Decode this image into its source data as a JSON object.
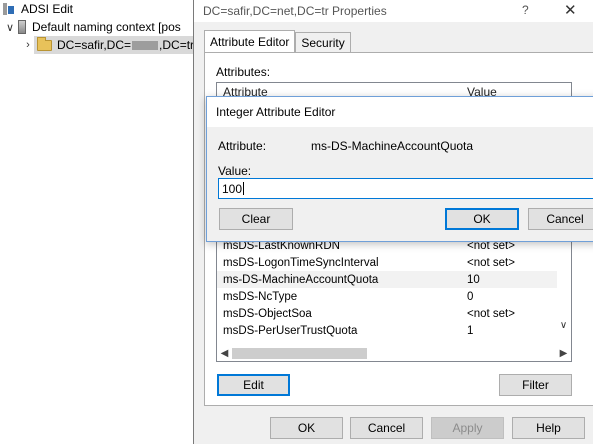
{
  "tree": {
    "root_label": "ADSI Edit",
    "context_label": "Default naming context [pos",
    "node_label_prefix": "DC=safir,DC=",
    "node_label_suffix": ",DC=tr"
  },
  "properties": {
    "title": "DC=safir,DC=net,DC=tr Properties",
    "help_glyph": "?",
    "close_glyph": "✕",
    "tabs": [
      "Attribute Editor",
      "Security"
    ],
    "attributes_label": "Attributes:",
    "columns": [
      "Attribute",
      "Value"
    ],
    "rows": [
      {
        "attr": "msDS-LastKnownRDN",
        "value": "<not set>"
      },
      {
        "attr": "msDS-LogonTimeSyncInterval",
        "value": "<not set>"
      },
      {
        "attr": "ms-DS-MachineAccountQuota",
        "value": "10"
      },
      {
        "attr": "msDS-NcType",
        "value": "0"
      },
      {
        "attr": "msDS-ObjectSoa",
        "value": "<not set>"
      },
      {
        "attr": "msDS-PerUserTrustQuota",
        "value": "1"
      }
    ],
    "edit_label": "Edit",
    "filter_label": "Filter",
    "ok_label": "OK",
    "cancel_label": "Cancel",
    "apply_label": "Apply",
    "help_label": "Help"
  },
  "dialog": {
    "title": "Integer Attribute Editor",
    "attribute_label": "Attribute:",
    "attribute_value": "ms-DS-MachineAccountQuota",
    "value_label": "Value:",
    "value": "100",
    "clear_label": "Clear",
    "ok_label": "OK",
    "cancel_label": "Cancel"
  }
}
